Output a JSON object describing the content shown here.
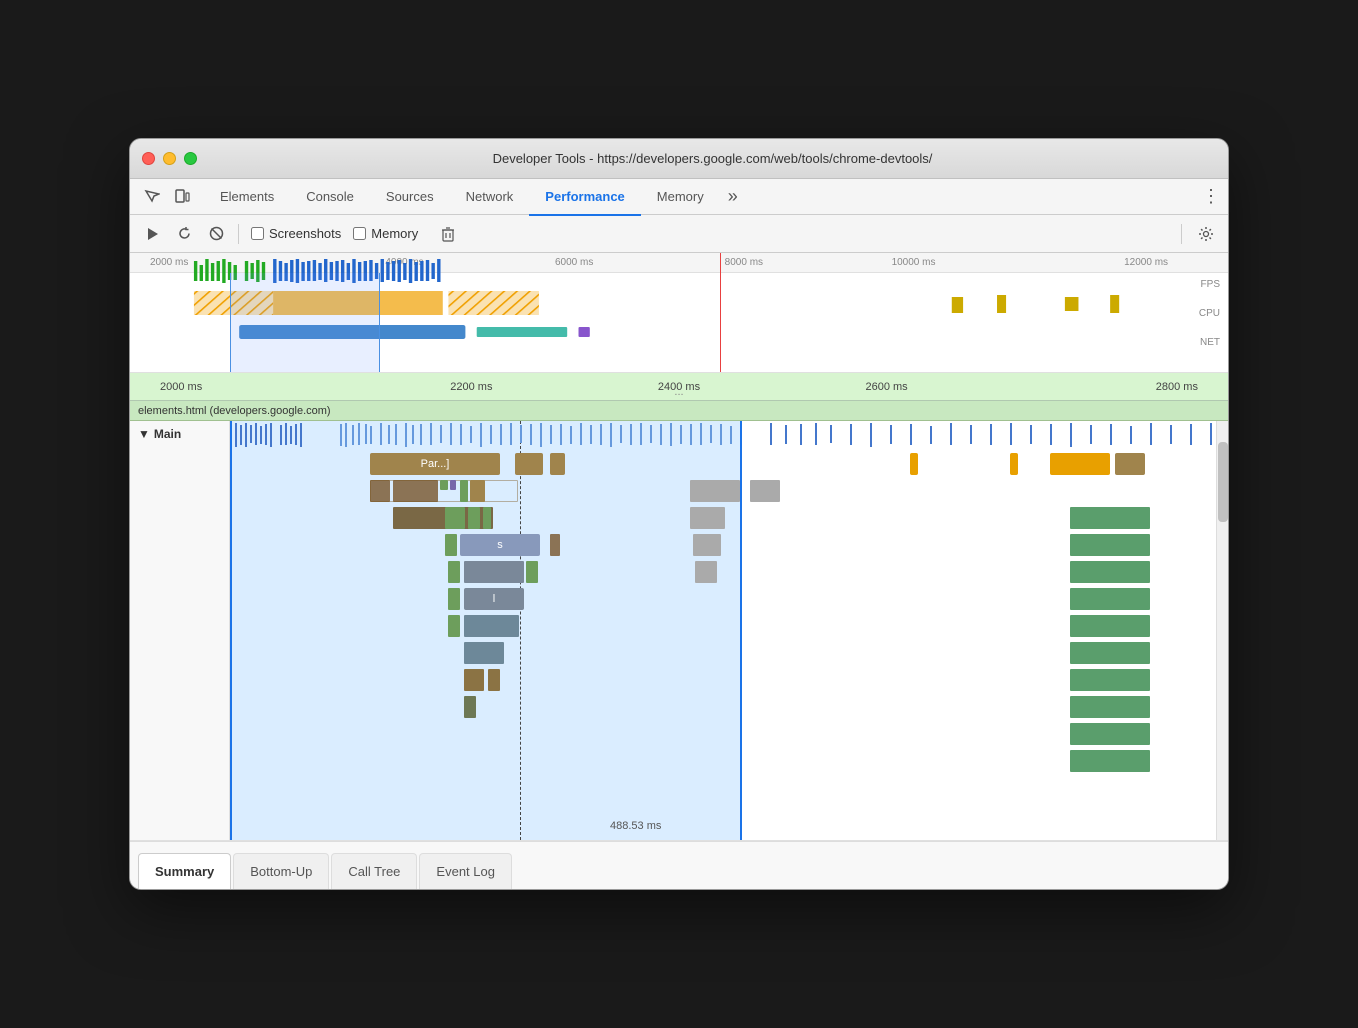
{
  "window": {
    "title": "Developer Tools - https://developers.google.com/web/tools/chrome-devtools/"
  },
  "nav": {
    "tabs": [
      {
        "id": "elements",
        "label": "Elements",
        "active": false
      },
      {
        "id": "console",
        "label": "Console",
        "active": false
      },
      {
        "id": "sources",
        "label": "Sources",
        "active": false
      },
      {
        "id": "network",
        "label": "Network",
        "active": false
      },
      {
        "id": "performance",
        "label": "Performance",
        "active": true
      },
      {
        "id": "memory",
        "label": "Memory",
        "active": false
      }
    ],
    "more_label": "»",
    "kebab_label": "⋮"
  },
  "toolbar": {
    "record_label": "▶",
    "reload_label": "↺",
    "clear_label": "⊘",
    "screenshots_label": "Screenshots",
    "memory_label": "Memory",
    "trash_label": "🗑",
    "gear_label": "⚙"
  },
  "timeline": {
    "ruler_marks": [
      "2000 ms",
      "4000 ms",
      "6000 ms",
      "8000 ms",
      "10000 ms",
      "12000 ms"
    ],
    "labels": [
      "FPS",
      "CPU",
      "NET"
    ]
  },
  "zoom": {
    "marks": [
      "2000 ms",
      "2200 ms",
      "2400 ms",
      "2600 ms",
      "2800 ms"
    ],
    "ellipsis": "..."
  },
  "url_strip": {
    "text": "elements.html (developers.google.com)"
  },
  "flame": {
    "section_label": "▼ Main",
    "time_label": "488.53 ms"
  },
  "bottom_tabs": [
    {
      "id": "summary",
      "label": "Summary",
      "active": true
    },
    {
      "id": "bottom-up",
      "label": "Bottom-Up",
      "active": false
    },
    {
      "id": "call-tree",
      "label": "Call Tree",
      "active": false
    },
    {
      "id": "event-log",
      "label": "Event Log",
      "active": false
    }
  ]
}
